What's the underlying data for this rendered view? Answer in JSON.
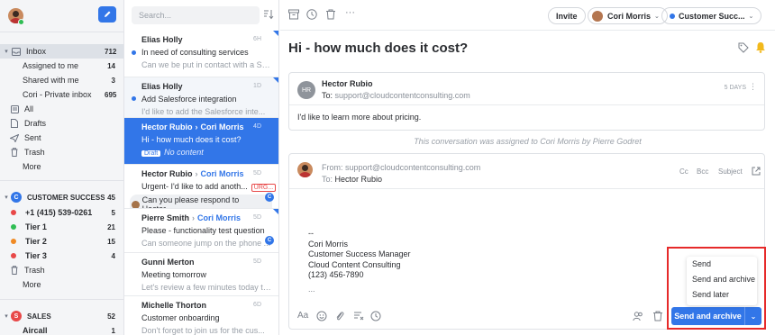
{
  "sidebar": {
    "inbox": {
      "label": "Inbox",
      "count": "712"
    },
    "sub_items": [
      {
        "label": "Assigned to me",
        "count": "14"
      },
      {
        "label": "Shared with me",
        "count": "3"
      },
      {
        "label": "Cori - Private inbox",
        "count": "695"
      }
    ],
    "folders": [
      {
        "label": "All",
        "icon": "list-icon"
      },
      {
        "label": "Drafts",
        "icon": "file-icon"
      },
      {
        "label": "Sent",
        "icon": "send-icon"
      },
      {
        "label": "Trash",
        "icon": "trash-icon"
      },
      {
        "label": "More",
        "icon": ""
      }
    ],
    "team_cs": {
      "badge": "C",
      "label": "CUSTOMER SUCCESS",
      "count": "45",
      "color": "#3276e8"
    },
    "cs_items": [
      {
        "label": "+1 (415) 539-0261",
        "count": "5",
        "color": "#e84848"
      },
      {
        "label": "Tier 1",
        "count": "21",
        "color": "#2fbd53"
      },
      {
        "label": "Tier 2",
        "count": "15",
        "color": "#f08a24"
      },
      {
        "label": "Tier 3",
        "count": "4",
        "color": "#e84848"
      }
    ],
    "cs_trash": "Trash",
    "cs_more": "More",
    "team_sales": {
      "badge": "S",
      "label": "SALES",
      "count": "52",
      "color": "#e84848"
    },
    "sales_items": [
      {
        "label": "Aircall",
        "count": "1"
      }
    ]
  },
  "list": {
    "search_placeholder": "Search...",
    "conversations": [
      {
        "from": "Elias Holly",
        "to": "",
        "age": "6H",
        "subject": "In need of consulting services",
        "preview": "Can we be put in contact with a Sales...",
        "unread": true
      },
      {
        "from": "Elias Holly",
        "to": "",
        "age": "1D",
        "subject": "Add Salesforce integration",
        "preview": "I'd like to add the Salesforce inte...",
        "unread": true
      },
      {
        "from": "Hector Rubio",
        "to": "Cori Morris",
        "age": "4D",
        "subject": "Hi - how much does it cost?",
        "draft_label": "Draft",
        "preview": "No content",
        "unread": false
      },
      {
        "from": "Hector Rubio",
        "to": "Cori Morris",
        "age": "5D",
        "subject": "Urgent- I'd like to add anoth...",
        "tag": "URG...",
        "chip": "Can you please respond to Hector...",
        "badge": "C"
      },
      {
        "from": "Pierre Smith",
        "to": "Cori Morris",
        "age": "5D",
        "subject": "Please - functionality test question",
        "preview": "Can someone jump on the phone ...",
        "badge": "C"
      },
      {
        "from": "Gunni Merton",
        "to": "",
        "age": "5D",
        "subject": "Meeting tomorrow",
        "preview": "Let's review a few minutes today to ..."
      },
      {
        "from": "Michelle Thorton",
        "to": "",
        "age": "6D",
        "subject": "Customer onboarding",
        "preview": "Don't forget to join us for the cus..."
      }
    ]
  },
  "main": {
    "invite_label": "Invite",
    "assignee": "Cori Morris",
    "inbox_select": "Customer Succ...",
    "subject": "Hi - how much does it cost?",
    "message": {
      "initials": "HR",
      "sender": "Hector Rubio",
      "to_label": "To:",
      "to_address": "support@cloudcontentconsulting.com",
      "age": "5 DAYS",
      "body": "I'd like to learn more about pricing."
    },
    "system_note": "This conversation was assigned to Cori Morris by Pierre Godret",
    "reply": {
      "from_label": "From:",
      "from_address": "support@cloudcontentconsulting.com",
      "to_label": "To:",
      "to_name": "Hector Rubio",
      "cc": "Cc",
      "bcc": "Bcc",
      "subject_btn": "Subject",
      "signature": [
        "--",
        "Cori Morris",
        "Customer Success Manager",
        "Cloud Content Consulting",
        "(123) 456-7890"
      ],
      "ellipsis": "..."
    },
    "send_label": "Send and archive",
    "send_menu": [
      "Send",
      "Send and archive",
      "Send later"
    ]
  }
}
